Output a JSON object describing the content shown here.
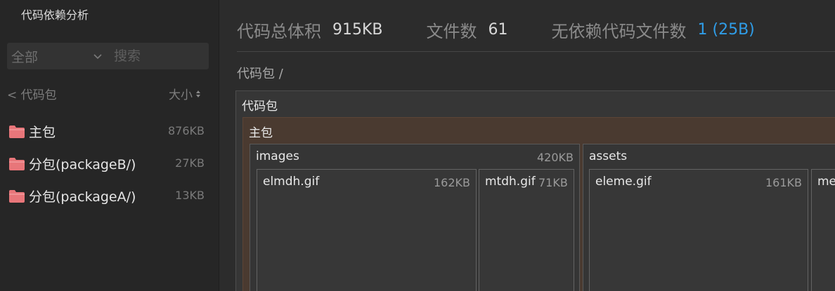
{
  "sidebar": {
    "title": "代码依赖分析",
    "scope_select": {
      "value": "全部",
      "icon": "chevron-down-icon"
    },
    "search": {
      "placeholder": "搜索",
      "value": ""
    },
    "back_label": "< 代码包",
    "sort_label": "大小",
    "items": [
      {
        "label": "主包",
        "size": "876KB",
        "icon": "folder-icon"
      },
      {
        "label": "分包(packageB/)",
        "size": "27KB",
        "icon": "folder-icon"
      },
      {
        "label": "分包(packageA/)",
        "size": "13KB",
        "icon": "folder-icon"
      }
    ]
  },
  "stats": {
    "total_size_label": "代码总体积",
    "total_size_value": "915KB",
    "file_count_label": "文件数",
    "file_count_value": "61",
    "unused_label": "无依赖代码文件数",
    "unused_value": "1 (25B)"
  },
  "breadcrumb": "代码包 /",
  "treemap": {
    "root": {
      "label": "代码包"
    },
    "main": {
      "label": "主包"
    },
    "images": {
      "label": "images",
      "size": "420KB",
      "children": [
        {
          "label": "elmdh.gif",
          "size": "162KB"
        },
        {
          "label": "mtdh.gif",
          "size": "71KB"
        }
      ]
    },
    "assets": {
      "label": "assets",
      "children": [
        {
          "label": "eleme.gif",
          "size": "161KB"
        },
        {
          "label": "me"
        }
      ]
    }
  },
  "colors": {
    "link": "#2f9de8",
    "folder": "#e8767a",
    "main_package_bg": "#4a3a30"
  }
}
